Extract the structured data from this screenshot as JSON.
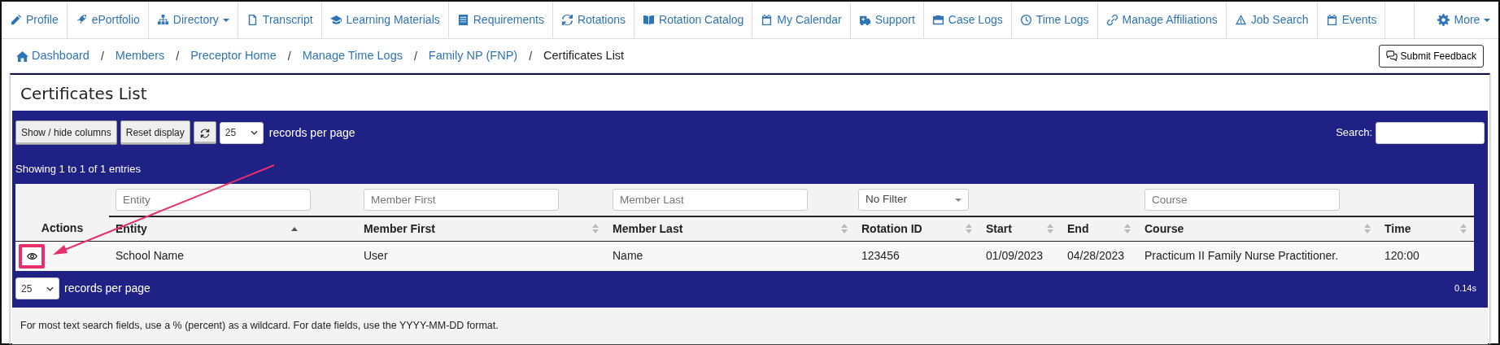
{
  "nav": [
    {
      "label": "Profile",
      "dropdown": false
    },
    {
      "label": "ePortfolio",
      "dropdown": false
    },
    {
      "label": "Directory",
      "dropdown": true
    },
    {
      "label": "Transcript",
      "dropdown": false
    },
    {
      "label": "Learning Materials",
      "dropdown": false
    },
    {
      "label": "Requirements",
      "dropdown": false
    },
    {
      "label": "Rotations",
      "dropdown": false
    },
    {
      "label": "Rotation Catalog",
      "dropdown": false
    },
    {
      "label": "My Calendar",
      "dropdown": false
    },
    {
      "label": "Support",
      "dropdown": false
    },
    {
      "label": "Case Logs",
      "dropdown": false
    },
    {
      "label": "Time Logs",
      "dropdown": false
    },
    {
      "label": "Manage Affiliations",
      "dropdown": false
    },
    {
      "label": "Job Search",
      "dropdown": false
    },
    {
      "label": "Events",
      "dropdown": false
    }
  ],
  "nav_more": {
    "label": "More",
    "dropdown": true
  },
  "breadcrumb": [
    {
      "label": "Dashboard",
      "link": true,
      "divider": "/"
    },
    {
      "label": "Members",
      "link": true,
      "divider": "/"
    },
    {
      "label": "Preceptor Home",
      "link": true,
      "divider": "/"
    },
    {
      "label": "Manage Time Logs",
      "link": true,
      "divider": "/"
    },
    {
      "label": "Family NP (FNP)",
      "link": true,
      "divider": "/"
    },
    {
      "label": "Certificates List",
      "link": false
    }
  ],
  "feedback_button": "Submit Feedback",
  "card_title": "Certificates List",
  "toolbar": {
    "buttons": [
      "Show / hide columns",
      "Reset display"
    ],
    "page_size": "25",
    "page_size_label": "records per page",
    "search_label": "Search:"
  },
  "showing": "Showing 1 to 1 of 1 entries",
  "table": {
    "actions_header": "Actions",
    "columns": [
      {
        "label": "Entity",
        "sorted": true,
        "filter": {
          "kind": "text",
          "placeholder": "Entity"
        }
      },
      {
        "label": "Member First",
        "sorted": false,
        "filter": {
          "kind": "text",
          "placeholder": "Member First"
        }
      },
      {
        "label": "Member Last",
        "sorted": false,
        "filter": {
          "kind": "text",
          "placeholder": "Member Last"
        }
      },
      {
        "label": "Rotation ID",
        "sorted": false,
        "filter": {
          "kind": "select",
          "value": "No Filter"
        }
      },
      {
        "label": "Start",
        "sorted": false
      },
      {
        "label": "End",
        "sorted": false
      },
      {
        "label": "Course",
        "sorted": false,
        "filter": {
          "kind": "text",
          "placeholder": "Course"
        }
      },
      {
        "label": "Time",
        "sorted": false
      }
    ],
    "rows": [
      {
        "view_highlighted": true,
        "cells": [
          "School Name",
          "User",
          "Name",
          "123456",
          "01/09/2023",
          "04/28/2023",
          "Practicum II Family Nurse Practitioner.",
          "120:00"
        ]
      }
    ]
  },
  "footer_bar": {
    "page_size": "25",
    "page_size_label": "records per page",
    "timing": "0.14s"
  },
  "note": "For most text search fields, use a % (percent) as a wildcard. For date fields, use the YYYY-MM-DD format."
}
